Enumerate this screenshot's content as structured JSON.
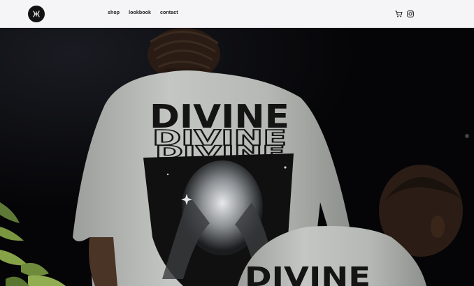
{
  "header": {
    "logo_icon": "brand-monogram-icon",
    "nav": [
      {
        "label": "shop"
      },
      {
        "label": "lookbook"
      },
      {
        "label": "contact"
      }
    ],
    "icons": [
      "cart-icon",
      "instagram-icon"
    ]
  },
  "hero": {
    "print_text": "DIVINE",
    "accent_color": "#b9bbb8",
    "background_color": "#0a0a0c"
  }
}
